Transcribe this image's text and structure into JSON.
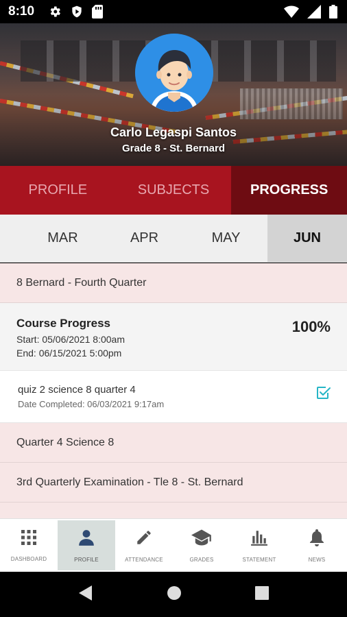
{
  "status_bar": {
    "time": "8:10"
  },
  "profile": {
    "name": "Carlo Legaspi Santos",
    "grade": "Grade 8 - St. Bernard"
  },
  "tabs": [
    {
      "label": "PROFILE",
      "active": false
    },
    {
      "label": "SUBJECTS",
      "active": false
    },
    {
      "label": "PROGRESS",
      "active": true
    }
  ],
  "months": [
    {
      "label": "MAR",
      "active": false
    },
    {
      "label": "APR",
      "active": false
    },
    {
      "label": "MAY",
      "active": false
    },
    {
      "label": "JUN",
      "active": true
    }
  ],
  "content": {
    "section_1": "8 Bernard - Fourth Quarter",
    "course_progress": {
      "title": "Course Progress",
      "start": "Start: 05/06/2021 8:00am",
      "end": "End: 06/15/2021 5:00pm",
      "percent": "100%"
    },
    "task": {
      "name": "quiz 2 science 8 quarter 4",
      "date": "Date Completed: 06/03/2021 9:17am",
      "completed": true
    },
    "section_2": "Quarter 4 Science 8",
    "section_3": "3rd Quarterly Examination - Tle 8 - St. Bernard"
  },
  "bottom_nav": [
    {
      "label": "DASHBOARD",
      "icon": "grid-icon",
      "active": false
    },
    {
      "label": "PROFILE",
      "icon": "person-icon",
      "active": true
    },
    {
      "label": "ATTENDANCE",
      "icon": "pencil-icon",
      "active": false
    },
    {
      "label": "GRADES",
      "icon": "graduation-cap-icon",
      "active": false
    },
    {
      "label": "STATEMENT",
      "icon": "bar-chart-icon",
      "active": false
    },
    {
      "label": "NEWS",
      "icon": "bell-icon",
      "active": false
    }
  ],
  "colors": {
    "primary": "#a8141f",
    "primary_dark": "#6e0c12",
    "accent_check": "#26b5c6",
    "section_bg": "#f7e6e6"
  }
}
